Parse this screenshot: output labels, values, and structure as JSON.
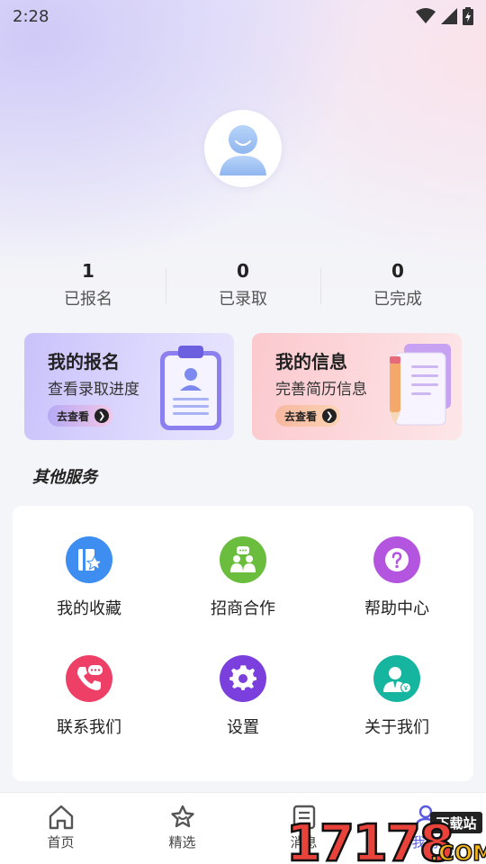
{
  "status_bar": {
    "time": "2:28",
    "icons": [
      "wifi-icon",
      "signal-icon",
      "battery-charging-icon"
    ]
  },
  "profile": {
    "avatar_icon": "user-avatar-icon"
  },
  "stats": [
    {
      "value": "1",
      "label": "已报名"
    },
    {
      "value": "0",
      "label": "已录取"
    },
    {
      "value": "0",
      "label": "已完成"
    }
  ],
  "cards": [
    {
      "title": "我的报名",
      "subtitle": "查看录取进度",
      "button": "去查看",
      "icon": "clipboard-icon"
    },
    {
      "title": "我的信息",
      "subtitle": "完善简历信息",
      "button": "去查看",
      "icon": "document-pencil-icon"
    }
  ],
  "section_title": "其他服务",
  "services": [
    {
      "label": "我的收藏",
      "icon": "favorites-icon",
      "color": "#3d8ef0"
    },
    {
      "label": "招商合作",
      "icon": "cooperation-icon",
      "color": "#6bbd3e"
    },
    {
      "label": "帮助中心",
      "icon": "help-icon",
      "color": "#b455e0"
    },
    {
      "label": "联系我们",
      "icon": "phone-chat-icon",
      "color": "#ee3f67"
    },
    {
      "label": "设置",
      "icon": "gear-icon",
      "color": "#7a3fdc"
    },
    {
      "label": "关于我们",
      "icon": "about-user-icon",
      "color": "#15b5a0"
    }
  ],
  "tabbar": [
    {
      "label": "首页",
      "icon": "home-icon"
    },
    {
      "label": "精选",
      "icon": "star-icon"
    },
    {
      "label": "消息",
      "icon": "message-icon"
    },
    {
      "label": "我的",
      "icon": "profile-icon"
    }
  ],
  "watermark": {
    "text": "17178",
    "suffix": ".COM",
    "badge": "下载站"
  }
}
